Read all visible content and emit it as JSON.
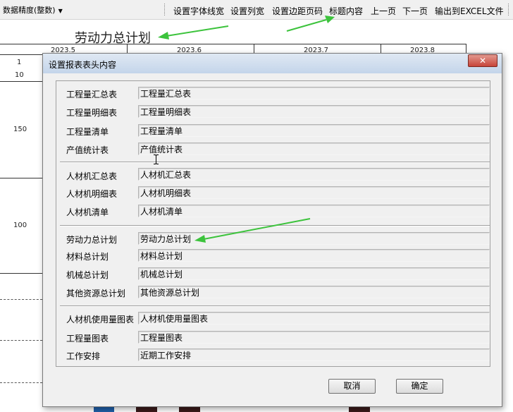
{
  "toolbar": {
    "precision_select": "数据精度(整数)",
    "buttons": [
      "设置字体线宽",
      "设置列宽",
      "设置边距页码",
      "标题内容",
      "上一页",
      "下一页",
      "输出到EXCEL文件"
    ]
  },
  "report": {
    "title": "劳动力总计划",
    "months": [
      "2023.5",
      "2023.6",
      "2023.7",
      "2023.8"
    ],
    "row_values": [
      "1",
      "10",
      "150",
      "100"
    ]
  },
  "dialog": {
    "title": "设置报表表头内容",
    "close_label": "✕",
    "groups": [
      [
        {
          "label": "工程量汇总表",
          "value": "工程量汇总表"
        },
        {
          "label": "工程量明细表",
          "value": "工程量明细表"
        },
        {
          "label": "工程量清单",
          "value": "工程量清单"
        },
        {
          "label": "产值统计表",
          "value": "产值统计表"
        }
      ],
      [
        {
          "label": "人材机汇总表",
          "value": "人材机汇总表"
        },
        {
          "label": "人材机明细表",
          "value": "人材机明细表"
        },
        {
          "label": "人材机清单",
          "value": "人材机清单"
        }
      ],
      [
        {
          "label": "劳动力总计划",
          "value": "劳动力总计划"
        },
        {
          "label": "材料总计划",
          "value": "材料总计划"
        },
        {
          "label": "机械总计划",
          "value": "机械总计划"
        },
        {
          "label": "其他资源总计划",
          "value": "其他资源总计划"
        }
      ],
      [
        {
          "label": "人材机使用量图表",
          "value": "人材机使用量图表"
        },
        {
          "label": "工程量图表",
          "value": "工程量图表"
        },
        {
          "label": "工作安排",
          "value": "近期工作安排"
        }
      ]
    ],
    "cancel_label": "取消",
    "ok_label": "确定"
  },
  "colors": {
    "arrow": "#3cc33c",
    "close_button": "#c7453a",
    "bar_blue": "#1f5fa8",
    "bar_dark": "#3a1a1a"
  }
}
